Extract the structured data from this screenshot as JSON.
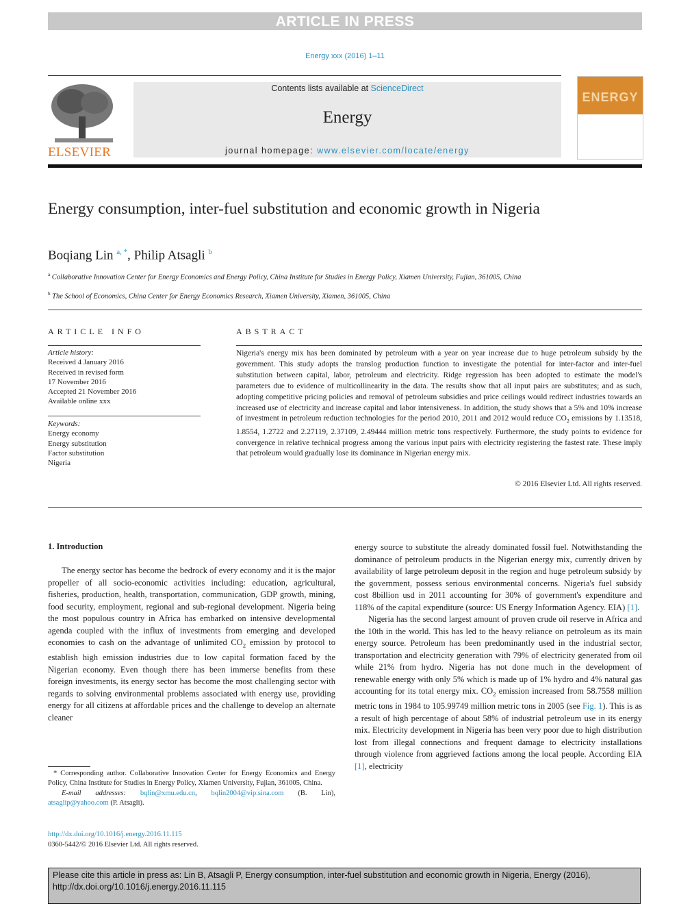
{
  "banner": {
    "text": "ARTICLE IN PRESS"
  },
  "journal_ref": "Energy xxx (2016) 1–11",
  "header": {
    "publisher": "ELSEVIER",
    "contents_prefix": "Contents lists available at ",
    "contents_link": "ScienceDirect",
    "journal_name": "Energy",
    "homepage_prefix": "journal homepage: ",
    "homepage_link": "www.elsevier.com/locate/energy",
    "cover_title": "ENERGY"
  },
  "article": {
    "title": "Energy consumption, inter-fuel substitution and economic growth in Nigeria",
    "authors": [
      {
        "name": "Boqiang Lin",
        "marks": "a, *"
      },
      {
        "name": "Philip Atsagli",
        "marks": "b"
      }
    ],
    "author_separator": ", ",
    "affiliations": [
      {
        "mark": "a",
        "text": "Collaborative Innovation Center for Energy Economics and Energy Policy, China Institute for Studies in Energy Policy, Xiamen University, Fujian, 361005, China"
      },
      {
        "mark": "b",
        "text": "The School of Economics, China Center for Energy Economics Research, Xiamen University, Xiamen, 361005, China"
      }
    ]
  },
  "article_info": {
    "heading": "ARTICLE INFO",
    "history_label": "Article history:",
    "history": [
      "Received 4 January 2016",
      "Received in revised form",
      "17 November 2016",
      "Accepted 21 November 2016",
      "Available online xxx"
    ],
    "keywords_label": "Keywords:",
    "keywords": [
      "Energy economy",
      "Energy substitution",
      "Factor substitution",
      "Nigeria"
    ]
  },
  "abstract": {
    "heading": "ABSTRACT",
    "text_1": "Nigeria's energy mix has been dominated by petroleum with a year on year increase due to huge petroleum subsidy by the government. This study adopts the translog production function to investigate the potential for inter-factor and inter-fuel substitution between capital, labor, petroleum and electricity. Ridge regression has been adopted to estimate the model's parameters due to evidence of multicollinearity in the data. The results show that all input pairs are substitutes; and as such, adopting competitive pricing policies and removal of petroleum subsidies and price ceilings would redirect industries towards an increased use of electricity and increase capital and labor intensiveness. In addition, the study shows that a 5% and 10% increase of investment in petroleum reduction technologies for the period 2010, 2011 and 2012 would reduce CO",
    "sub": "2",
    "text_2": " emissions by 1.13518, 1.8554, 1.2722 and 2.27119, 2.37109, 2.49444 million metric tons respectively. Furthermore, the study points to evidence for convergence in relative technical progress among the various input pairs with electricity registering the fastest rate. These imply that petroleum would gradually lose its dominance in Nigerian energy mix.",
    "copyright": "© 2016 Elsevier Ltd. All rights reserved."
  },
  "body": {
    "section_heading": "1.  Introduction",
    "col1_p1_a": "The energy sector has become the bedrock of every economy and it is the major propeller of all socio-economic activities including: education, agricultural, fisheries, production, health, transportation, communication, GDP growth, mining, food security, employment, regional and sub-regional development. Nigeria being the most populous country in Africa has embarked on intensive developmental agenda coupled with the influx of investments from emerging and developed economies to cash on the advantage of unlimited CO",
    "col1_p1_sub": "2",
    "col1_p1_b": " emission by protocol to establish high emission industries due to low capital formation faced by the Nigerian economy. Even though there has been immerse benefits from these foreign investments, its energy sector has become the most challenging sector with regards to solving environmental problems associated with energy use, providing energy for all citizens at affordable prices and the challenge to develop an alternate cleaner",
    "col2_p1": "energy source to substitute the already dominated fossil fuel. Notwithstanding the dominance of petroleum products in the Nigerian energy mix, currently driven by availability of large petroleum deposit in the region and huge petroleum subsidy by the government, possess serious environmental concerns. Nigeria's fuel subsidy cost 8billion usd in 2011 accounting for 30% of government's expenditure and 118% of the capital expenditure (source: US Energy Information Agency. EIA) ",
    "ref1": "[1]",
    "col2_p1_end": ".",
    "col2_p2_a": "Nigeria has the second largest amount of proven crude oil reserve in Africa and the 10th in the world. This has led to the heavy reliance on petroleum as its main energy source. Petroleum has been predominantly used in the industrial sector, transportation and electricity generation with 79% of electricity generated from oil while 21% from hydro. Nigeria has not done much in the development of renewable energy with only 5% which is made up of 1% hydro and 4% natural gas accounting for its total energy mix. CO",
    "col2_p2_sub": "2",
    "col2_p2_b": " emission increased from 58.7558 million metric tons in 1984 to 105.99749 million metric tons in 2005 (see ",
    "fig_ref": "Fig. 1",
    "col2_p2_c": "). This is as a result of high percentage of about 58% of industrial petroleum use in its energy mix. Electricity development in Nigeria has been very poor due to high distribution lost from illegal connections and frequent damage to electricity installations through violence from aggrieved factions among the local people. According EIA ",
    "col2_p2_d": ", electricity"
  },
  "footnote": {
    "corresponding": "* Corresponding author. Collaborative Innovation Center for Energy Economics and Energy Policy, China Institute for Studies in Energy Policy, Xiamen University, Fujian, 361005, China.",
    "email_label": "E-mail addresses: ",
    "email1": "bqlin@xmu.edu.cn",
    "sep": ", ",
    "email2": "bqlin2004@vip.sina.com",
    "email2_owner": " (B. Lin), ",
    "email3": "atsaglip@yahoo.com",
    "email3_owner": " (P. Atsagli)."
  },
  "doi": {
    "link": "http://dx.doi.org/10.1016/j.energy.2016.11.115",
    "issn": "0360-5442/© 2016 Elsevier Ltd. All rights reserved."
  },
  "citation_box": {
    "text": "Please cite this article in press as: Lin B, Atsagli P, Energy consumption, inter-fuel substitution and economic growth in Nigeria, Energy (2016), http://dx.doi.org/10.1016/j.energy.2016.11.115"
  },
  "colors": {
    "link": "#2a8fbd",
    "elsevier_orange": "#e87722",
    "banner_gray": "#c8c8c8",
    "cover_orange": "#d98a2e"
  }
}
